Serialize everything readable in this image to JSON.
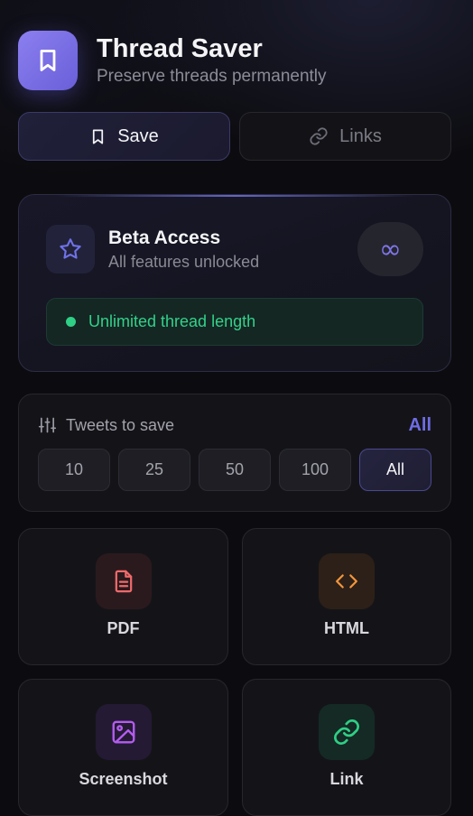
{
  "app": {
    "title": "Thread Saver",
    "subtitle": "Preserve threads permanently",
    "logo_icon": "bookmark-icon",
    "accent": "#7b6fe6"
  },
  "tabs": [
    {
      "label": "Save",
      "icon": "bookmark-icon",
      "active": true
    },
    {
      "label": "Links",
      "icon": "link-icon",
      "active": false
    }
  ],
  "beta": {
    "title": "Beta Access",
    "subtitle": "All features unlocked",
    "icon": "star-icon",
    "badge": "∞",
    "feature": "Unlimited thread length",
    "feature_color": "#33d18a"
  },
  "tweets": {
    "label": "Tweets to save",
    "icon": "sliders-icon",
    "selected": "All",
    "options": [
      "10",
      "25",
      "50",
      "100",
      "All"
    ]
  },
  "formats": [
    {
      "label": "PDF",
      "icon": "document-icon",
      "color": "#f06a6a"
    },
    {
      "label": "HTML",
      "icon": "code-icon",
      "color": "#f2953c"
    },
    {
      "label": "Screenshot",
      "icon": "image-icon",
      "color": "#b45cf0"
    },
    {
      "label": "Link",
      "icon": "link-icon",
      "color": "#2fcf86"
    }
  ]
}
